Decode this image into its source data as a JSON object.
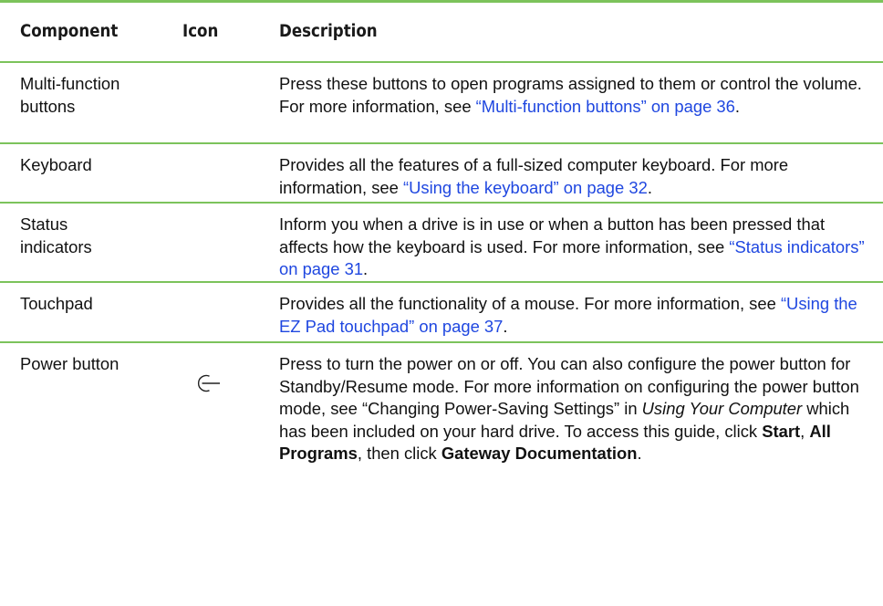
{
  "header": {
    "component": "Component",
    "icon": "Icon",
    "description": "Description"
  },
  "rows": [
    {
      "component": "Multi-function buttons",
      "desc_text": "Press these buttons to open programs assigned to them or control the volume. For more information, see ",
      "desc_link": "“Multi-function buttons” on page 36",
      "desc_end": "."
    },
    {
      "component": "Keyboard",
      "desc_text": "Provides all the features of a full-sized computer keyboard. For more information, see ",
      "desc_link": "“Using the keyboard” on page 32",
      "desc_end": "."
    },
    {
      "component": "Status indicators",
      "desc_text": "Inform you when a drive is in use or when a button has been pressed that affects how the keyboard is used. For more information, see ",
      "desc_link": "“Status indicators” on page 31",
      "desc_end": "."
    },
    {
      "component": "Touchpad",
      "desc_text": "Provides all the functionality of a mouse. For more information, see ",
      "desc_link": "“Using the EZ Pad touchpad” on page 37",
      "desc_end": "."
    },
    {
      "component": "Power button",
      "icon": "power-icon",
      "desc_p1": "Press to turn the power on or off. You can also configure the power button for Standby/Resume mode. For more information on configuring the power button mode, see “Changing Power-Saving Settings” in ",
      "desc_italic": "Using Your Computer",
      "desc_p2": " which has been included on your hard drive. To access this guide, click ",
      "bold_start": "Start",
      "sep1": ", ",
      "bold_programs": "All Programs",
      "sep2": ", then click ",
      "bold_docs": "Gateway Documentation",
      "desc_end": "."
    }
  ],
  "colors": {
    "rule": "#7cc35b",
    "link": "#1f47e0",
    "text": "#111111"
  }
}
